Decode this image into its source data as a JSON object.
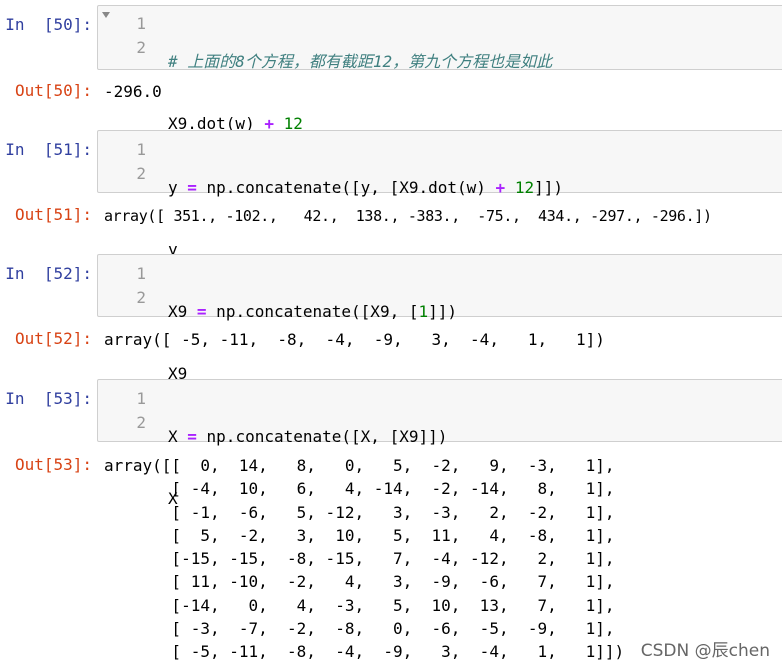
{
  "cells": [
    {
      "in_prompt": "In  [50]:",
      "line_numbers": [
        "1",
        "2"
      ],
      "code": {
        "l1_comment": "# 上面的8个方程，都有截距12，第九个方程也是如此",
        "l2_a": "X9.dot(w) ",
        "l2_op": "+",
        "l2_space": " ",
        "l2_num": "12"
      },
      "out_prompt": "Out[50]:",
      "output": "-296.0"
    },
    {
      "in_prompt": "In  [51]:",
      "line_numbers": [
        "1",
        "2"
      ],
      "code": {
        "l1_a": "y ",
        "l1_op1": "=",
        "l1_b": " np.concatenate([y, [X9.dot(w) ",
        "l1_op2": "+",
        "l1_space": " ",
        "l1_num": "12",
        "l1_c": "]])",
        "l2": "y"
      },
      "out_prompt": "Out[51]:",
      "output": "array([ 351., -102.,   42.,  138., -383.,  -75.,  434., -297., -296.])"
    },
    {
      "in_prompt": "In  [52]:",
      "line_numbers": [
        "1",
        "2"
      ],
      "code": {
        "l1_a": "X9 ",
        "l1_op": "=",
        "l1_b": " np.concatenate([X9, [",
        "l1_num": "1",
        "l1_c": "]])",
        "l2": "X9"
      },
      "out_prompt": "Out[52]:",
      "output": "array([ -5, -11,  -8,  -4,  -9,   3,  -4,   1,   1])"
    },
    {
      "in_prompt": "In  [53]:",
      "line_numbers": [
        "1",
        "2"
      ],
      "code": {
        "l1_a": "X ",
        "l1_op": "=",
        "l1_b": " np.concatenate([X, [X9]])",
        "l2": "X"
      },
      "out_prompt": "Out[53]:",
      "output": "array([[  0,  14,   8,   0,   5,  -2,   9,  -3,   1],\n       [ -4,  10,   6,   4, -14,  -2, -14,   8,   1],\n       [ -1,  -6,   5, -12,   3,  -3,   2,  -2,   1],\n       [  5,  -2,   3,  10,   5,  11,   4,  -8,   1],\n       [-15, -15,  -8, -15,   7,  -4, -12,   2,   1],\n       [ 11, -10,  -2,   4,   3,  -9,  -6,   7,   1],\n       [-14,   0,   4,  -3,   5,  10,  13,   7,   1],\n       [ -3,  -7,  -2,  -8,   0,  -6,  -5,  -9,   1],\n       [ -5, -11,  -8,  -4,  -9,   3,  -4,   1,   1]])"
    }
  ],
  "watermark": "CSDN @辰chen"
}
